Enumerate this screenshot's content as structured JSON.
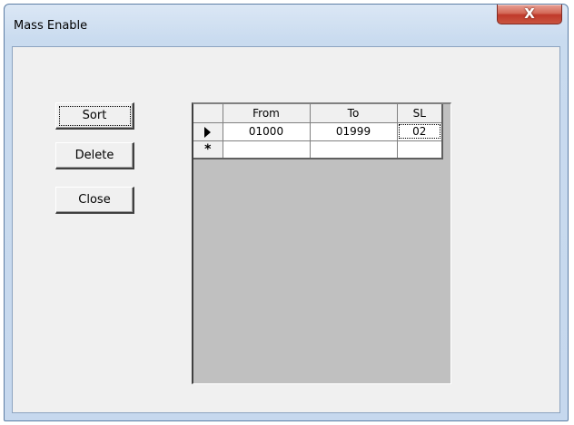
{
  "window": {
    "title": "Mass Enable",
    "close_glyph": "X"
  },
  "buttons": {
    "sort_label": "Sort",
    "delete_label": "Delete",
    "close_label": "Close"
  },
  "grid": {
    "columns": [
      "From",
      "To",
      "SL"
    ],
    "rows": [
      {
        "indicator": "current-row-arrow",
        "from": "01000",
        "to": "01999",
        "sl": "02"
      }
    ],
    "new_row_glyph": "*"
  },
  "colors": {
    "close_button": "#c9553f",
    "dialog_background": "#f0f0f0",
    "grid_background": "#c0c0c0",
    "title_bar": "#c9dbef"
  }
}
